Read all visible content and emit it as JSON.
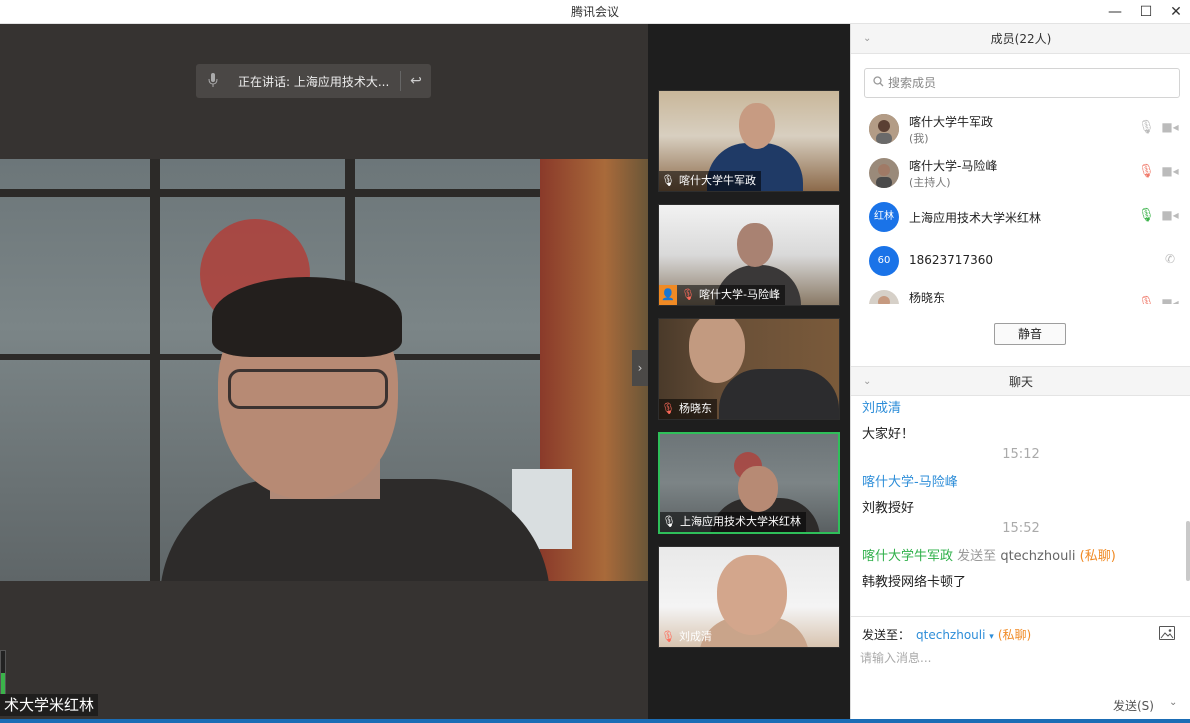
{
  "window": {
    "title": "腾讯会议",
    "minimize_glyph": "—",
    "maximize_glyph": "☐",
    "close_glyph": "✕"
  },
  "stage": {
    "speaking_label": "正在讲话: 上海应用技术大...",
    "main_name": "术大学米红林",
    "mic_level": 0.6
  },
  "thumbnails": [
    {
      "name": "喀什大学牛军政",
      "mic": "on"
    },
    {
      "name": "喀什大学-马险峰",
      "mic": "muted",
      "host": true
    },
    {
      "name": "杨晓东",
      "mic": "muted"
    },
    {
      "name": "上海应用技术大学米红林",
      "mic": "on",
      "active": true
    },
    {
      "name": "刘成清",
      "mic": "muted"
    }
  ],
  "members_section": {
    "title": "成员(22人)",
    "search_placeholder": "搜索成员",
    "members": [
      {
        "name": "喀什大学牛军政",
        "role": "(我)",
        "avatar": "photo",
        "mic": "off-grey",
        "cam": "off-grey"
      },
      {
        "name": "喀什大学-马险峰",
        "role": "(主持人)",
        "avatar": "photo",
        "mic": "muted-red",
        "cam": "off-grey"
      },
      {
        "name": "上海应用技术大学米红林",
        "role": "",
        "avatar_text": "红林",
        "avatar_color": "#1a73e8",
        "mic": "on-green",
        "cam": "off-grey"
      },
      {
        "name": "18623717360",
        "role": "",
        "avatar_text": "60",
        "avatar_color": "#1a73e8",
        "phone": true
      },
      {
        "name": "杨晓东",
        "role": "",
        "avatar": "photo",
        "mic": "muted-red",
        "cam": "off-grey"
      }
    ],
    "mute_all_label": "静音"
  },
  "chat_section": {
    "title": "聊天",
    "messages": [
      {
        "sender": "刘成清",
        "text": "大家好！"
      },
      {
        "time": "15:12"
      },
      {
        "sender": "喀什大学-马险峰",
        "text": "刘教授好"
      },
      {
        "time": "15:52"
      },
      {
        "sender": "喀什大学牛军政",
        "sent_to_label": "发送至",
        "target": "qtechzhouli",
        "private_label": "(私聊)",
        "text": "韩教授网络卡顿了"
      }
    ],
    "compose": {
      "send_to_label": "发送至：",
      "target": "qtechzhouli",
      "target_caret": "▾",
      "private_label": "(私聊)",
      "placeholder": "请输入消息...",
      "send_label": "发送(S)",
      "send_caret": "⌄"
    }
  },
  "colors": {
    "accent_blue": "#1a73e8",
    "link_blue": "#2d8dd8",
    "self_green": "#2fb04a",
    "private_orange": "#f08a24",
    "active_border": "#2fbf5a"
  }
}
